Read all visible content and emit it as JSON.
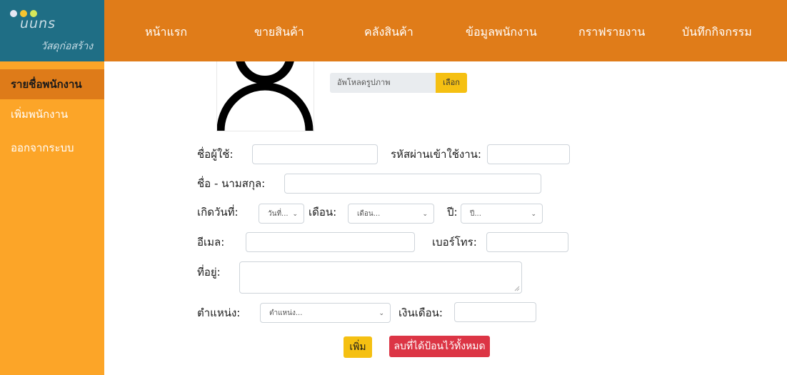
{
  "brand": {
    "name": "uuns",
    "tagline": "วัสดุก่อสร้าง",
    "dot_colors": [
      "#e6e6f2",
      "#f4c430",
      "#d6e85a"
    ]
  },
  "nav": {
    "items": [
      {
        "label": "หน้าแรก"
      },
      {
        "label": "ขายสินค้า"
      },
      {
        "label": "คลังสินค้า"
      },
      {
        "label": "ข้อมูลพนักงาน"
      },
      {
        "label": "กราฟรายงาน"
      },
      {
        "label": "บันทึกกิจกรรม"
      }
    ]
  },
  "sidebar": {
    "items": [
      {
        "label": "รายชื่อพนักงาน",
        "active": true
      },
      {
        "label": "เพิ่มพนักงาน"
      },
      {
        "label": "ออกจากระบบ"
      }
    ]
  },
  "upload": {
    "placeholder": "อัพโหลดรูปภาพ",
    "button_label": "เลือก"
  },
  "form": {
    "username_label": "ชื่อผู้ใช้:",
    "password_label": "รหัสผ่านเข้าใช้งาน:",
    "fullname_label": "ชื่อ - นามสกุล:",
    "birthday_label": "เกิดวันที่:",
    "day_select": "วันที่...",
    "month_label": "เดือน:",
    "month_select": "เดือน...",
    "year_label": "ปี:",
    "year_select": "ปี...",
    "email_label": "อีเมล:",
    "phone_label": "เบอร์โทร:",
    "address_label": "ที่อยู่:",
    "position_label": "ตำแหน่ง:",
    "position_select": "ตำแหน่ง...",
    "salary_label": "เงินเดือน:",
    "add_button": "เพิ่ม",
    "clear_button": "ลบที่ได้ป้อนไว้ทั้งหมด"
  },
  "colors": {
    "topbar": "#e07c19",
    "logo_bg": "#1f6e85",
    "sidebar": "#fca528",
    "sidebar_active": "#de7b19",
    "add_button": "#f5c012",
    "clear_button": "#dc3545"
  }
}
